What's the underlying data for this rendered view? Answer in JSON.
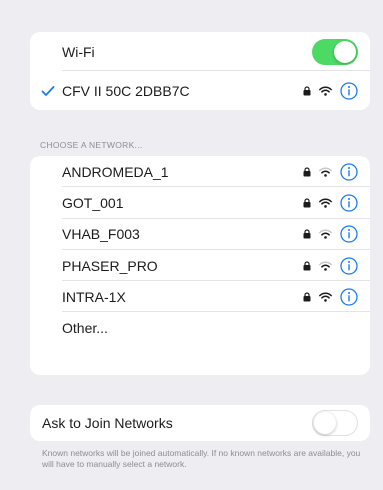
{
  "wifi": {
    "label": "Wi-Fi",
    "enabled": true,
    "accent_color": "#4cd964",
    "connected": {
      "name": "CFV II 50C 2DBB7C",
      "check_color": "#1a7cf5",
      "secured": true,
      "info_icon": "info-circle-icon"
    }
  },
  "section_header": "CHOOSE A NETWORK...",
  "networks": [
    {
      "name": "ANDROMEDA_1",
      "secured": true
    },
    {
      "name": "GOT_001",
      "secured": true
    },
    {
      "name": "VHAB_F003",
      "secured": true
    },
    {
      "name": "PHASER_PRO",
      "secured": true
    },
    {
      "name": "INTRA-1X",
      "secured": true
    }
  ],
  "other_label": "Other...",
  "ask_to_join": {
    "label": "Ask to Join Networks",
    "enabled": false
  },
  "footer_text": "Known networks will be joined automatically. If no known networks are available, you will have to manually select a network.",
  "info_color": "#1a7cf5"
}
